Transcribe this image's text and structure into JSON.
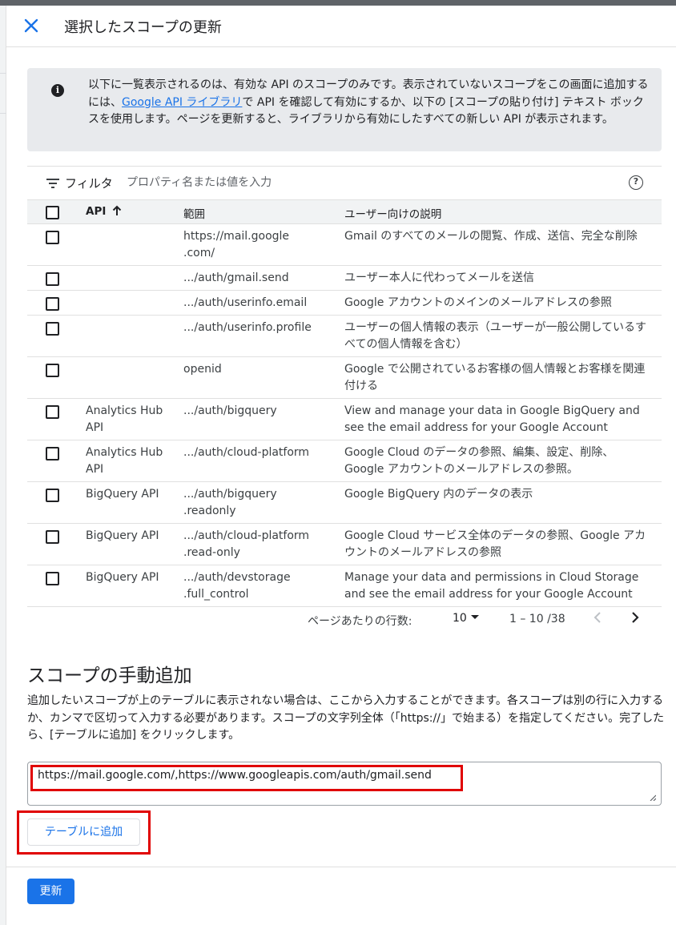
{
  "dialog": {
    "title": "選択したスコープの更新"
  },
  "info": {
    "text_before": "以下に一覧表示されるのは、有効な API のスコープのみです。表示されていないスコープをこの画面に追加するには、",
    "link": "Google API ライブラリ",
    "text_after": "で API を確認して有効にするか、以下の [スコープの貼り付け] テキスト ボックスを使用します。ページを更新すると、ライブラリから有効にしたすべての新しい API が表示されます。"
  },
  "filter": {
    "label": "フィルタ",
    "placeholder": "プロパティ名または値を入力"
  },
  "table": {
    "headers": {
      "api": "API",
      "scope": "範囲",
      "description": "ユーザー向けの説明"
    },
    "rows": [
      {
        "api": "",
        "scope": "https://mail.google\n.com/",
        "description": "Gmail のすべてのメールの閲覧、作成、送信、完全な削除"
      },
      {
        "api": "",
        "scope": ".../auth/gmail.send",
        "description": "ユーザー本人に代わってメールを送信"
      },
      {
        "api": "",
        "scope": ".../auth/userinfo.email",
        "description": "Google アカウントのメインのメールアドレスの参照"
      },
      {
        "api": "",
        "scope": ".../auth/userinfo.profile",
        "description": "ユーザーの個人情報の表示（ユーザーが一般公開しているすべての個人情報を含む）"
      },
      {
        "api": "",
        "scope": "openid",
        "description": "Google で公開されているお客様の個人情報とお客様を関連付ける"
      },
      {
        "api": "Analytics Hub API",
        "scope": ".../auth/bigquery",
        "description": "View and manage your data in Google BigQuery and see the email address for your Google Account"
      },
      {
        "api": "Analytics Hub API",
        "scope": ".../auth/cloud-platform",
        "description": "Google Cloud のデータの参照、編集、設定、削除、Google アカウントのメールアドレスの参照。"
      },
      {
        "api": "BigQuery API",
        "scope": ".../auth/bigquery\n.readonly",
        "description": "Google BigQuery 内のデータの表示"
      },
      {
        "api": "BigQuery API",
        "scope": ".../auth/cloud-platform\n.read-only",
        "description": "Google Cloud サービス全体のデータの参照、Google アカウントのメールアドレスの参照"
      },
      {
        "api": "BigQuery API",
        "scope": ".../auth/devstorage\n.full_control",
        "description": "Manage your data and permissions in Cloud Storage and see the email address for your Google Account"
      }
    ]
  },
  "pagination": {
    "rows_label": "ページあたりの行数:",
    "rows_value": "10",
    "range": "1 – 10 /38"
  },
  "manual": {
    "title": "スコープの手動追加",
    "description": "追加したいスコープが上のテーブルに表示されない場合は、ここから入力することができます。各スコープは別の行に入力するか、カンマで区切って入力する必要があります。スコープの文字列全体（「https://」で始まる）を指定してください。完了したら、[テーブルに追加] をクリックします。",
    "textarea_value": "https://mail.google.com/,https://www.googleapis.com/auth/gmail.send",
    "add_button": "テーブルに追加"
  },
  "footer": {
    "update_button": "更新"
  },
  "colors": {
    "accent": "#1a73e8",
    "highlight": "#e00000",
    "info_bg": "#e8eaed"
  }
}
